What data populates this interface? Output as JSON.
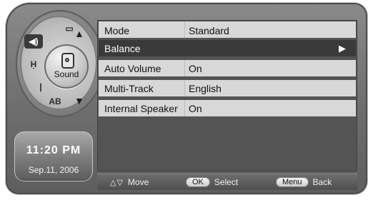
{
  "menu": {
    "rows": [
      {
        "label": "Mode",
        "value": "Standard"
      },
      {
        "label": "Balance",
        "value": "",
        "selected": true,
        "indicator": "▶"
      },
      {
        "label": "Auto Volume",
        "value": "On"
      },
      {
        "label": "Multi-Track",
        "value": "English"
      },
      {
        "label": "Internal Speaker",
        "value": "On"
      }
    ]
  },
  "sidebar": {
    "center_label": "Sound",
    "wheel_icons": [
      {
        "name": "screen-icon",
        "text": "▭"
      },
      {
        "name": "sound-icon",
        "text": "◀)"
      },
      {
        "name": "channel-icon",
        "text": "Ḥ"
      },
      {
        "name": "tuning-icon",
        "text": "ꟾ"
      },
      {
        "name": "ab-icon",
        "text": "AB"
      }
    ],
    "up_arrow": "▲",
    "down_arrow": "▼"
  },
  "status": {
    "time": "11:20 PM",
    "date": "Sep.11, 2006"
  },
  "help": {
    "move": "Move",
    "move_icons": "△▽",
    "ok_key": "OK",
    "select": "Select",
    "menu_key": "Menu",
    "back": "Back"
  }
}
